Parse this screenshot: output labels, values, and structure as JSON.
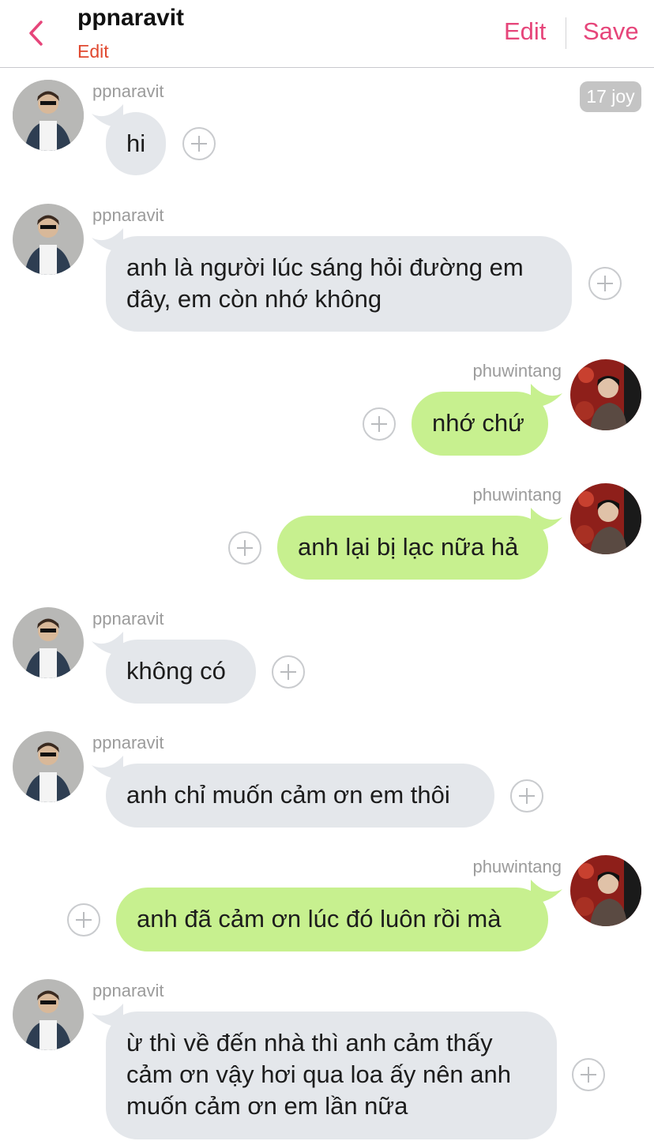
{
  "header": {
    "title": "ppnaravit",
    "subtitle": "Edit",
    "edit_label": "Edit",
    "save_label": "Save"
  },
  "badge": "17 joy",
  "messages": [
    {
      "side": "left",
      "sender": "ppnaravit",
      "text": "hi"
    },
    {
      "side": "left",
      "sender": "ppnaravit",
      "text": "anh là người lúc sáng hỏi đường em\nđây, em còn nhớ không"
    },
    {
      "side": "right",
      "sender": "phuwintang",
      "text": "nhớ chứ"
    },
    {
      "side": "right",
      "sender": "phuwintang",
      "text": "anh lại bị lạc nữa hả"
    },
    {
      "side": "left",
      "sender": "ppnaravit",
      "text": "không có"
    },
    {
      "side": "left",
      "sender": "ppnaravit",
      "text": "anh chỉ muốn cảm ơn em thôi"
    },
    {
      "side": "right",
      "sender": "phuwintang",
      "text": "anh đã cảm ơn lúc đó luôn rồi mà"
    },
    {
      "side": "left",
      "sender": "ppnaravit",
      "text": "ừ thì về đến nhà thì anh cảm thấy\ncảm ơn vậy hơi qua loa ấy nên anh\nmuốn cảm ơn em lần nữa"
    }
  ],
  "colors": {
    "accent": "#e6457a",
    "subtitle": "#e0482f",
    "bubble_gray": "#e4e7eb",
    "bubble_green": "#c7f08f"
  },
  "icons": {
    "back": "chevron-left-icon",
    "add_reaction": "plus-circle-icon"
  }
}
